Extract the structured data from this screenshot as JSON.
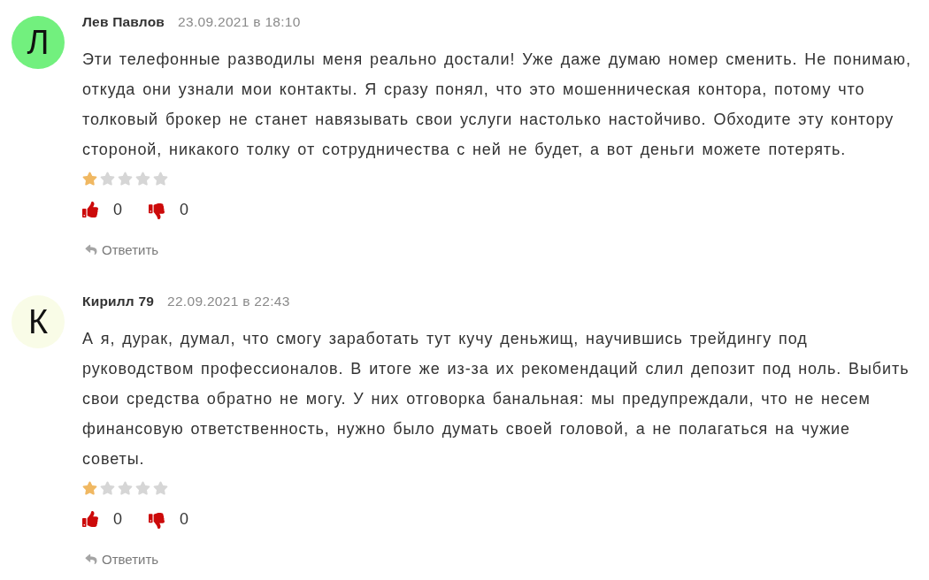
{
  "comments": [
    {
      "avatar_letter": "Л",
      "color": "#72f07e",
      "author": "Лев Павлов",
      "date": "23.09.2021 в 18:10",
      "text": "Эти телефонные разводилы меня реально достали! Уже даже думаю номер сменить. Не понимаю, откуда они узнали мои контакты. Я сразу понял, что это мошенническая контора, потому что толковый брокер не станет навязывать свои услуги настолько настойчиво. Обходите эту контору стороной, никакого толку от сотрудничества с ней не будет, а вот деньги можете потерять.",
      "stars": 1,
      "likes": "0",
      "dislikes": "0",
      "reply_label": "Ответить"
    },
    {
      "avatar_letter": "К",
      "color": "#f9fce7",
      "author": "Кирилл 79",
      "date": "22.09.2021 в 22:43",
      "text": "А я, дурак, думал, что смогу заработать тут кучу деньжищ, научившись трейдингу под руководством профессионалов. В итоге же из-за их рекомендаций слил депозит под ноль. Выбить свои средства обратно не могу. У них отговорка банальная: мы предупреждали, что не несем финансовую ответственность, нужно было думать своей головой, а не полагаться на чужие советы.",
      "stars": 1,
      "likes": "0",
      "dislikes": "0",
      "reply_label": "Ответить"
    }
  ]
}
